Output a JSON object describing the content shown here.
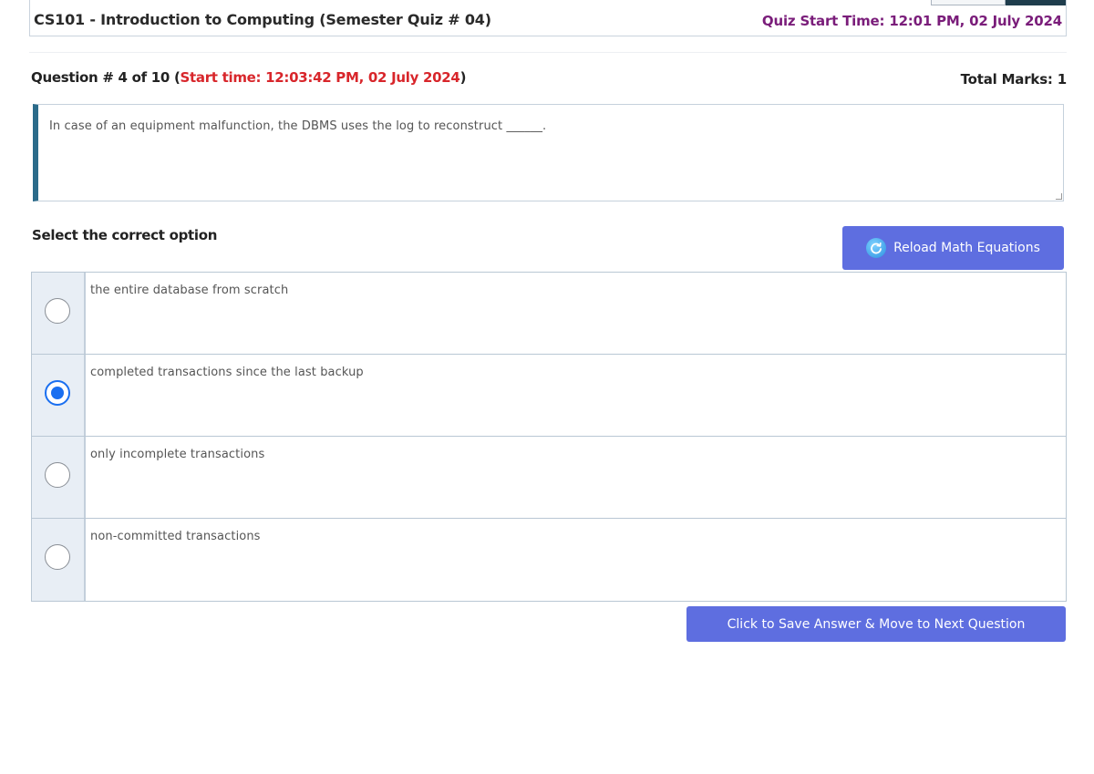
{
  "header": {
    "course_title": "CS101 - Introduction to Computing (Semester Quiz # 04)",
    "quiz_start": "Quiz Start Time: 12:01 PM, 02 July 2024"
  },
  "question": {
    "label_prefix": "Question # 4 of 10 (",
    "start_time": "Start time: 12:03:42 PM, 02 July 2024",
    "label_suffix": ")",
    "total_marks": "Total Marks: 1",
    "text": "In case of an equipment malfunction, the DBMS uses the log to reconstruct ______."
  },
  "select_label": "Select the correct option",
  "reload_button": "Reload Math Equations",
  "options": [
    {
      "text": "the entire database from scratch",
      "selected": false
    },
    {
      "text": "completed transactions since the last backup",
      "selected": true
    },
    {
      "text": "only incomplete transactions",
      "selected": false
    },
    {
      "text": "non-committed transactions",
      "selected": false
    }
  ],
  "save_button": "Click to Save Answer & Move to Next Question",
  "colors": {
    "button": "#5e6ee0",
    "start_time_red": "#d8262b",
    "quiz_start_purple": "#7a1d7a",
    "radio_selected": "#1a6ff0"
  },
  "icons": {
    "reload": "reload-icon"
  }
}
